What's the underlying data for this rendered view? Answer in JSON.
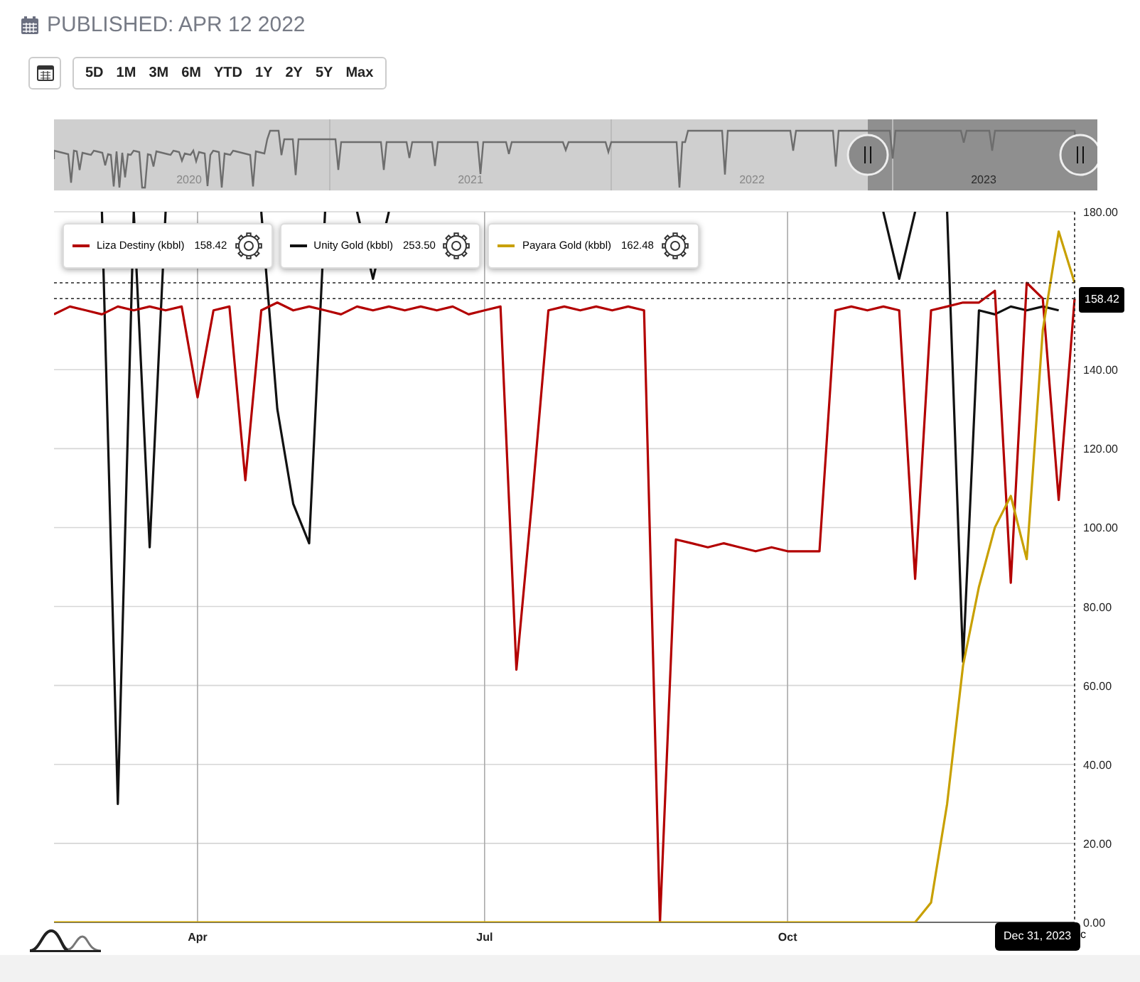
{
  "header": {
    "title": "PUBLISHED: APR 12 2022"
  },
  "range_buttons": [
    {
      "label": "5D",
      "selected": false
    },
    {
      "label": "1M",
      "selected": false
    },
    {
      "label": "3M",
      "selected": false
    },
    {
      "label": "6M",
      "selected": false
    },
    {
      "label": "YTD",
      "selected": false
    },
    {
      "label": "1Y",
      "selected": false
    },
    {
      "label": "2Y",
      "selected": false
    },
    {
      "label": "5Y",
      "selected": false
    },
    {
      "label": "Max",
      "selected": false
    }
  ],
  "navigator": {
    "years": [
      "2020",
      "2021",
      "2022",
      "2023"
    ],
    "level": 0.22
  },
  "legend": [
    {
      "value": "158.42"
    },
    {
      "value": "253.50"
    },
    {
      "value": "162.48"
    }
  ],
  "crosshair": {
    "value_label": "158.42",
    "date_label": "Dec 31, 2023",
    "hidden_axis_label": "c"
  },
  "chart_data": {
    "type": "line",
    "grid": true,
    "ref_lines": [
      {
        "axis": "y",
        "value": 158
      },
      {
        "axis": "y",
        "value": 162
      }
    ],
    "categories": [
      null,
      null,
      null,
      null,
      null,
      null,
      null,
      null,
      null,
      "Apr",
      null,
      null,
      null,
      null,
      null,
      null,
      null,
      null,
      null,
      null,
      null,
      null,
      null,
      null,
      null,
      null,
      null,
      "Jul",
      null,
      null,
      null,
      null,
      null,
      null,
      null,
      null,
      null,
      null,
      null,
      null,
      null,
      null,
      null,
      null,
      null,
      null,
      "Oct",
      null,
      null,
      null,
      null,
      null,
      null,
      null,
      null,
      null,
      null,
      null,
      null,
      null,
      null,
      null,
      null,
      null,
      null
    ],
    "series": [
      {
        "name": "Liza Destiny (kbbl)",
        "color": "#b30000",
        "values": [
          154,
          156,
          155,
          154,
          156,
          155,
          156,
          155,
          156,
          133,
          155,
          156,
          112,
          155,
          157,
          155,
          156,
          155,
          154,
          156,
          155,
          156,
          155,
          156,
          155,
          156,
          154,
          155,
          156,
          64,
          108,
          155,
          156,
          155,
          156,
          155,
          156,
          155,
          0,
          97,
          96,
          95,
          96,
          95,
          94,
          95,
          94,
          94,
          94,
          155,
          156,
          155,
          156,
          155,
          87,
          155,
          156,
          157,
          157,
          160,
          86,
          162,
          158,
          107,
          158
        ]
      },
      {
        "name": "Unity Gold (kbbl)",
        "color": "#111111",
        "values": [
          null,
          null,
          null,
          180,
          30,
          180,
          95,
          180,
          null,
          null,
          null,
          null,
          null,
          180,
          130,
          106,
          96,
          180,
          null,
          180,
          163,
          180,
          null,
          null,
          null,
          null,
          null,
          null,
          null,
          null,
          null,
          null,
          null,
          null,
          null,
          null,
          null,
          null,
          null,
          null,
          null,
          null,
          null,
          null,
          null,
          null,
          null,
          null,
          null,
          null,
          null,
          null,
          180,
          163,
          180,
          null,
          180,
          66,
          155,
          154,
          156,
          155,
          156,
          155,
          null
        ]
      },
      {
        "name": "Payara Gold (kbbl)",
        "color": "#c8a000",
        "values": [
          0,
          0,
          0,
          0,
          0,
          0,
          0,
          0,
          0,
          0,
          0,
          0,
          0,
          0,
          0,
          0,
          0,
          0,
          0,
          0,
          0,
          0,
          0,
          0,
          0,
          0,
          0,
          0,
          0,
          0,
          0,
          0,
          0,
          0,
          0,
          0,
          0,
          0,
          0,
          0,
          0,
          0,
          0,
          0,
          0,
          0,
          0,
          0,
          0,
          0,
          0,
          0,
          0,
          0,
          0,
          5,
          30,
          65,
          85,
          100,
          108,
          92,
          150,
          175,
          162
        ]
      }
    ],
    "ylim": [
      0,
      180
    ],
    "yticks": [
      {
        "value": 0,
        "label": "0.00"
      },
      {
        "value": 20,
        "label": "20.00"
      },
      {
        "value": 40,
        "label": "40.00"
      },
      {
        "value": 60,
        "label": "60.00"
      },
      {
        "value": 80,
        "label": "80.00"
      },
      {
        "value": 100,
        "label": "100.00"
      },
      {
        "value": 120,
        "label": "120.00"
      },
      {
        "value": 140,
        "label": "140.00"
      },
      {
        "value": 180,
        "label": "180.00"
      }
    ]
  }
}
